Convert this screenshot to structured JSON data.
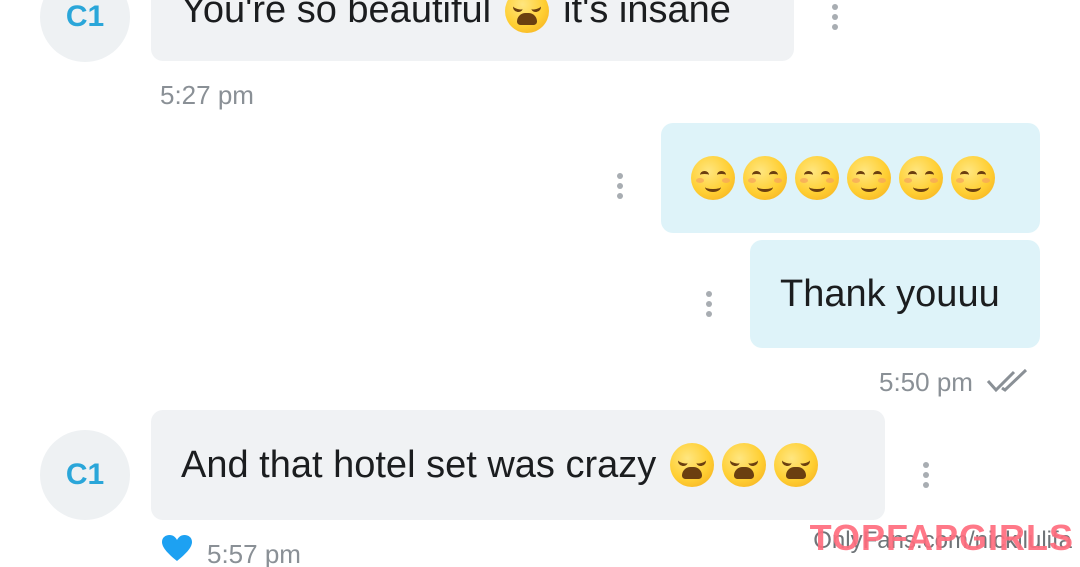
{
  "messages": [
    {
      "sender": "C1",
      "text_before": "You're so beautiful",
      "text_after": "it's insane",
      "emoji": "weary-face",
      "time": "5:27 pm"
    },
    {
      "emoji_row": "relieved-face x6"
    },
    {
      "text": "Thank youuu",
      "time": "5:50 pm",
      "status_icon": "double-check-icon"
    },
    {
      "sender": "C1",
      "text": "And that hotel set was crazy",
      "emoji": "weary-face x3",
      "time": "5:57 pm",
      "reaction_icon": "heart-icon"
    }
  ],
  "watermark": {
    "site": "OnlyFans.com/nickilulifa",
    "brand": "TOPFAPGIRLS"
  },
  "colors": {
    "incoming_bubble": "#f0f2f4",
    "outgoing_bubble": "#def3f9",
    "avatar_text": "#2aa6d9",
    "heart": "#1da1f2",
    "timestamp": "#8a9096",
    "brand": "#ff6d7e"
  }
}
